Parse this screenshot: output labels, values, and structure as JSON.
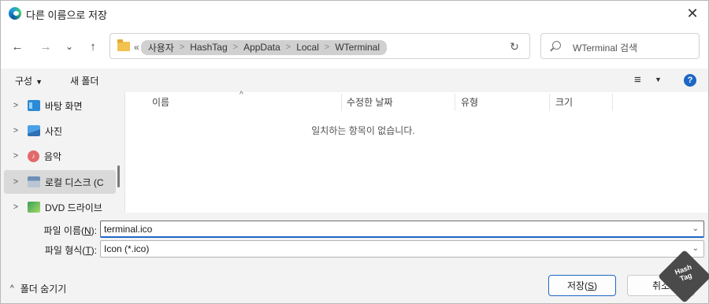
{
  "window": {
    "title": "다른 이름으로 저장",
    "close_glyph": "✕"
  },
  "nav": {
    "back_glyph": "←",
    "forward_glyph": "→",
    "recent_glyph": "⌄",
    "up_glyph": "↑",
    "refresh_glyph": "↻"
  },
  "address": {
    "more": "«",
    "crumbs": [
      "사용자",
      "HashTag",
      "AppData",
      "Local",
      "WTerminal"
    ],
    "separator": ">"
  },
  "search": {
    "placeholder": "WTerminal 검색"
  },
  "toolbar": {
    "organize_label": "구성",
    "organize_caret": "▼",
    "new_folder_label": "새 폴더",
    "view_glyph": "≡",
    "view_caret": "▼",
    "help_glyph": "?"
  },
  "sidebar": {
    "chevron": ">",
    "items": [
      {
        "label": "바탕 화면",
        "icon": "desktop-icon"
      },
      {
        "label": "사진",
        "icon": "pictures-icon"
      },
      {
        "label": "음악",
        "icon": "music-icon",
        "glyph": "♪"
      },
      {
        "label": "로컬 디스크 (C",
        "icon": "local-disk-icon"
      },
      {
        "label": "DVD 드라이브",
        "icon": "dvd-drive-icon"
      }
    ]
  },
  "columns": {
    "name": "이름",
    "modified": "수정한 날짜",
    "type": "유형",
    "size": "크기",
    "sort_glyph": "^"
  },
  "empty_message": "일치하는 항목이 없습니다.",
  "form": {
    "filename_label_pre": "파일 이름(",
    "filename_label_key": "N",
    "filename_label_post": "):",
    "filename_value": "terminal.ico",
    "filetype_label_pre": "파일 형식(",
    "filetype_label_key": "T",
    "filetype_label_post": "):",
    "filetype_value": "Icon (*.ico)",
    "dropdown_caret": "⌄"
  },
  "footer": {
    "hide_folders_label": "폴더 숨기기",
    "hide_folders_glyph": "^",
    "save_label_pre": "저장(",
    "save_label_key": "S",
    "save_label_post": ")",
    "cancel_label": "취소"
  },
  "watermark": {
    "line1": "Hash",
    "line2": "Tag"
  },
  "colors": {
    "accent": "#1d67c5",
    "pane_bg": "#f3f3f3",
    "selected_bg": "#d9d9d9"
  }
}
